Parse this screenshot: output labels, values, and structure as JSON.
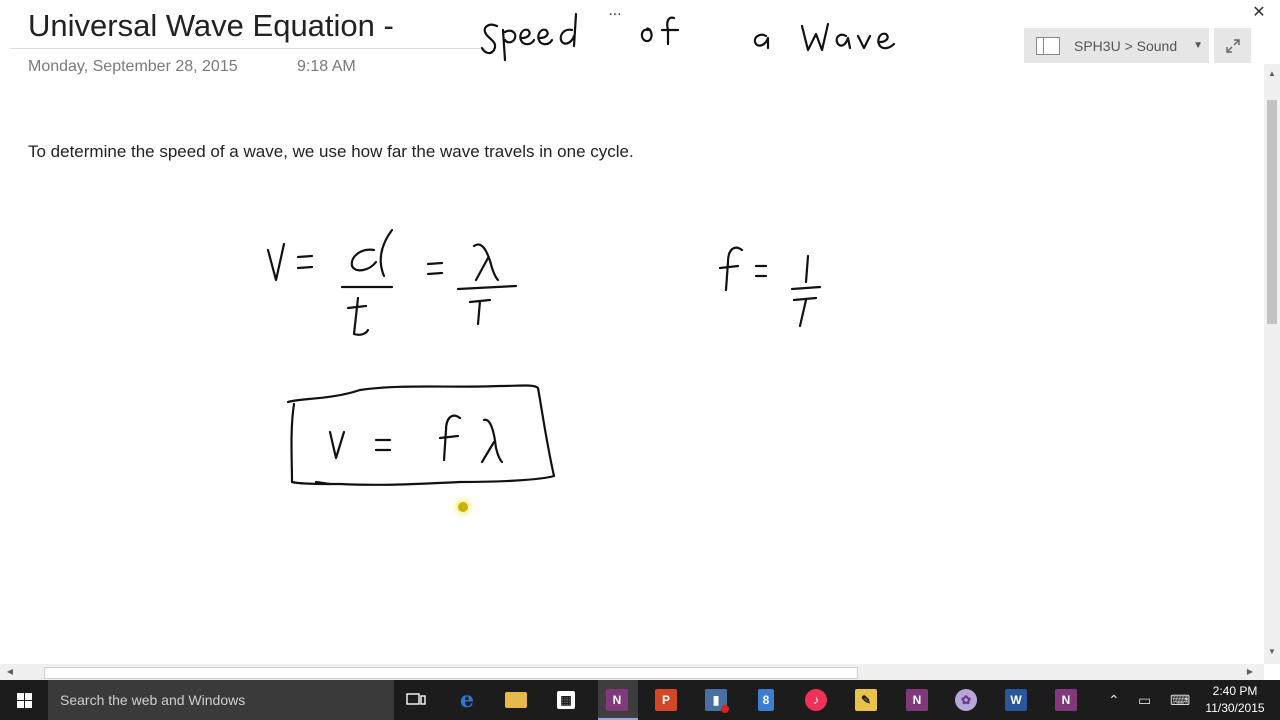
{
  "page": {
    "title": "Universal Wave Equation -",
    "date": "Monday, September 28, 2015",
    "time": "9:18 AM",
    "body_text": "To determine the speed of a wave, we use how far the wave travels in one cycle.",
    "more_label": "...",
    "ink_notes": [
      "Speed of a Wave",
      "v = d/t = λ/T",
      "f = 1/T",
      "v = fλ"
    ]
  },
  "header": {
    "breadcrumb": "SPH3U > Sound",
    "expand_icon": "expand-icon",
    "close_label": "✕"
  },
  "taskbar": {
    "search_placeholder": "Search the web and Windows",
    "apps": [
      "task-view",
      "edge",
      "file-explorer",
      "store",
      "onenote",
      "powerpoint",
      "media-app",
      "notepad",
      "itunes",
      "explorer",
      "onenote-2",
      "paint",
      "word",
      "onenote-3"
    ],
    "clock_time": "2:40 PM",
    "clock_date": "11/30/2015"
  },
  "colors": {
    "onenote": "#80397b",
    "taskbar": "#1c1c1c",
    "edge": "#2a79d8",
    "word": "#2b579a",
    "powerpoint": "#d24726",
    "itunes": "#f0325a",
    "folder": "#e8b84a"
  }
}
